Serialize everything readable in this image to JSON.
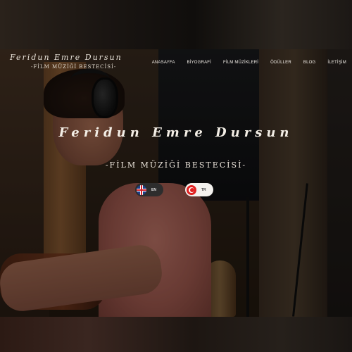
{
  "site": {
    "logo_name": "Feridun Emre Dursun",
    "logo_subtitle": "-FİLM MÜZİĞİ BESTECİSİ-"
  },
  "nav": {
    "items": [
      {
        "label": "ANASAYFA"
      },
      {
        "label": "BİYOGRAFİ"
      },
      {
        "label": "FİLM MÜZİKLERİ"
      },
      {
        "label": "ÖDÜLLER"
      },
      {
        "label": "BLOG"
      },
      {
        "label": "İLETİŞİM"
      }
    ]
  },
  "hero": {
    "title": "Feridun Emre Dursun",
    "subtitle": "-FİLM MÜZİĞİ BESTECİSİ-"
  },
  "languages": [
    {
      "code": "EN",
      "icon": "uk-flag-icon"
    },
    {
      "code": "TR",
      "icon": "turkey-flag-icon"
    }
  ],
  "colors": {
    "text": "#f1ece6",
    "lang_en_bg": "#2d2d2d",
    "lang_tr_bg": "#f3f1ee"
  }
}
